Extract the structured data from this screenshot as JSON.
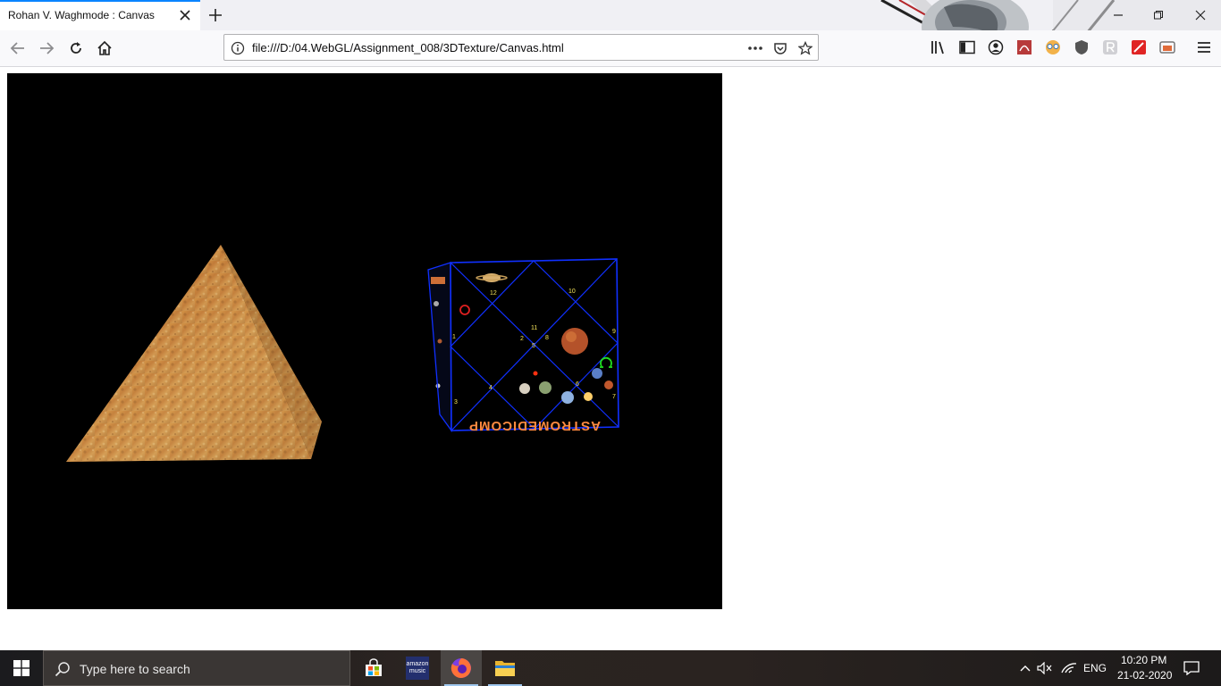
{
  "browser": {
    "tab": {
      "title": "Rohan V. Waghmode : Canvas"
    },
    "url": "file:///D:/04.WebGL/Assignment_008/3DTexture/Canvas.html"
  },
  "canvas_scene": {
    "cube_label": "ASTROMEDICOMP",
    "cube_numbers": [
      "12",
      "10",
      "11",
      "1",
      "2",
      "5",
      "8",
      "9",
      "4",
      "6",
      "3",
      "7"
    ]
  },
  "taskbar": {
    "search_placeholder": "Type here to search",
    "amazon_line1": "amazon",
    "amazon_line2": "music",
    "language": "ENG",
    "time": "10:20 PM",
    "date": "21-02-2020"
  },
  "colors": {
    "tab_accent": "#0a84ff",
    "cube_wire": "#1030ff",
    "label_orange": "#ff8a40"
  }
}
